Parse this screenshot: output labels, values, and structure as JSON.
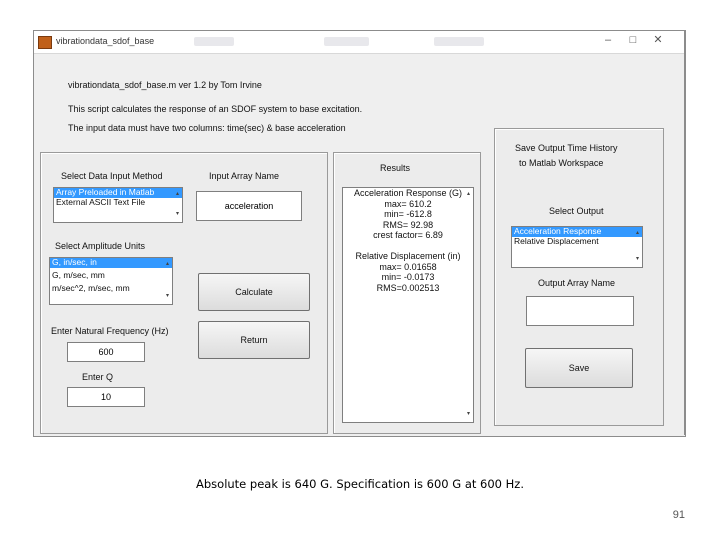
{
  "window": {
    "title": "vibrationdata_sdof_base",
    "background_tabs": [
      "New Calendar",
      "Analysis Tools"
    ],
    "icons": [
      "app-icon",
      "minimize-icon",
      "maximize-icon",
      "close-icon"
    ]
  },
  "header": {
    "line1": "vibrationdata_sdof_base.m   ver 1.2  by Tom Irvine",
    "line2": "This script calculates the response of an SDOF system to base excitation.",
    "line3": "The input data must have two columns: time(sec) & base acceleration"
  },
  "input_panel": {
    "data_input_label": "Select Data Input Method",
    "data_input_options": [
      "Array Preloaded in Matlab",
      "External ASCII Text File"
    ],
    "data_input_selected": 0,
    "array_name_label": "Input Array Name",
    "array_name_value": "acceleration",
    "amplitude_units_label": "Select Amplitude Units",
    "amplitude_units_options": [
      "G, in/sec, in",
      "G, m/sec, mm",
      "m/sec^2, m/sec, mm"
    ],
    "amplitude_units_selected": 0,
    "calculate_label": "Calculate",
    "return_label": "Return",
    "natural_freq_label": "Enter Natural Frequency (Hz)",
    "natural_freq_value": "600",
    "q_label": "Enter Q",
    "q_value": "10"
  },
  "results": {
    "title": "Results",
    "lines": [
      "Acceleration Response (G)",
      "max=  610.2",
      "min= -612.8",
      "RMS=  92.98",
      "crest factor=  6.89",
      "",
      "Relative Displacement (in)",
      "max= 0.01658",
      "min= -0.0173",
      "RMS=0.002513"
    ]
  },
  "save_panel": {
    "title_line1": "Save Output Time History",
    "title_line2": "to Matlab Workspace",
    "select_output_label": "Select Output",
    "output_options": [
      "Acceleration Response",
      "Relative Displacement"
    ],
    "output_selected": 0,
    "output_array_label": "Output Array Name",
    "output_array_value": "",
    "save_label": "Save"
  },
  "slide": {
    "caption": "Absolute peak is 640 G.  Specification is   600 G at 600 Hz.",
    "page_number": "91"
  },
  "colors": {
    "selection": "#3399ff",
    "window_bg": "#efefef",
    "app_icon": "#c0601a"
  }
}
